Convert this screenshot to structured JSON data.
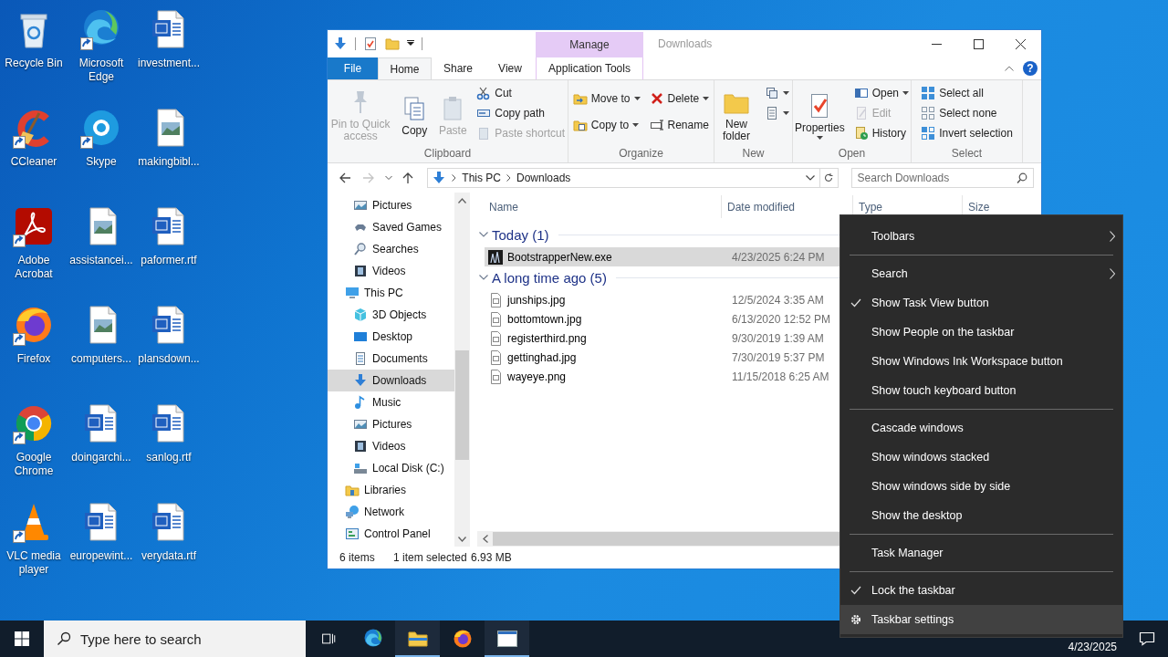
{
  "desktop": {
    "icons": [
      {
        "label": "Recycle Bin",
        "kind": "recycle_bin",
        "shortcut": false
      },
      {
        "label": "CCleaner",
        "kind": "ccleaner",
        "shortcut": true
      },
      {
        "label": "Adobe Acrobat",
        "kind": "acrobat",
        "shortcut": true
      },
      {
        "label": "Firefox",
        "kind": "firefox",
        "shortcut": true
      },
      {
        "label": "Google Chrome",
        "kind": "chrome",
        "shortcut": true
      },
      {
        "label": "VLC media player",
        "kind": "vlc",
        "shortcut": true
      },
      {
        "label": "Microsoft Edge",
        "kind": "edge",
        "shortcut": true
      },
      {
        "label": "Skype",
        "kind": "skype",
        "shortcut": true
      },
      {
        "label": "assistancei...",
        "kind": "image",
        "shortcut": false
      },
      {
        "label": "computers...",
        "kind": "image",
        "shortcut": false
      },
      {
        "label": "doingarchi...",
        "kind": "word",
        "shortcut": false
      },
      {
        "label": "europewint...",
        "kind": "word",
        "shortcut": false
      },
      {
        "label": "investment...",
        "kind": "word",
        "shortcut": false
      },
      {
        "label": "makingbibl...",
        "kind": "image",
        "shortcut": false
      },
      {
        "label": "paformer.rtf",
        "kind": "word",
        "shortcut": false
      },
      {
        "label": "plansdown...",
        "kind": "word",
        "shortcut": false
      },
      {
        "label": "sanlog.rtf",
        "kind": "word",
        "shortcut": false
      },
      {
        "label": "verydata.rtf",
        "kind": "word",
        "shortcut": false
      }
    ]
  },
  "explorer": {
    "title": "Downloads",
    "context_header": "Manage",
    "tabs": [
      {
        "label": "File",
        "kind": "file",
        "selected": false
      },
      {
        "label": "Home",
        "kind": "tab",
        "selected": true
      },
      {
        "label": "Share",
        "kind": "tab",
        "selected": false
      },
      {
        "label": "View",
        "kind": "tab",
        "selected": false
      },
      {
        "label": "Application Tools",
        "kind": "contextual",
        "selected": false
      }
    ],
    "help": "?",
    "ribbon": {
      "groups": [
        {
          "label": "Clipboard",
          "columns": [
            {
              "kind": "large",
              "items": [
                {
                  "label": "Pin to Quick access",
                  "disabled": true,
                  "dropdown": false
                }
              ]
            },
            {
              "kind": "large",
              "items": [
                {
                  "label": "Copy",
                  "disabled": false,
                  "dropdown": false
                }
              ]
            },
            {
              "kind": "large",
              "items": [
                {
                  "label": "Paste",
                  "disabled": true,
                  "dropdown": false
                }
              ]
            },
            {
              "kind": "small",
              "items": [
                {
                  "label": "Cut",
                  "disabled": false,
                  "dropdown": false
                },
                {
                  "label": "Copy path",
                  "disabled": false,
                  "dropdown": false
                },
                {
                  "label": "Paste shortcut",
                  "disabled": true,
                  "dropdown": false
                }
              ]
            }
          ]
        },
        {
          "label": "Organize",
          "columns": [
            {
              "kind": "small",
              "items": [
                {
                  "label": "Move to",
                  "disabled": false,
                  "dropdown": true
                },
                {
                  "label": "Copy to",
                  "disabled": false,
                  "dropdown": true
                }
              ]
            },
            {
              "kind": "small",
              "items": [
                {
                  "label": "Delete",
                  "disabled": false,
                  "dropdown": true
                },
                {
                  "label": "Rename",
                  "disabled": false,
                  "dropdown": false
                }
              ]
            }
          ]
        },
        {
          "label": "New",
          "columns": [
            {
              "kind": "large",
              "items": [
                {
                  "label": "New folder",
                  "disabled": false,
                  "dropdown": false
                }
              ]
            },
            {
              "kind": "small",
              "items": [
                {
                  "disabled": false,
                  "dropdown": true
                },
                {
                  "disabled": false,
                  "dropdown": true
                }
              ]
            }
          ]
        },
        {
          "label": "Open",
          "columns": [
            {
              "kind": "large",
              "items": [
                {
                  "label": "Properties",
                  "disabled": false,
                  "dropdown": true
                }
              ]
            },
            {
              "kind": "small",
              "items": [
                {
                  "label": "Open",
                  "disabled": false,
                  "dropdown": true
                },
                {
                  "label": "Edit",
                  "disabled": true,
                  "dropdown": false
                },
                {
                  "label": "History",
                  "disabled": false,
                  "dropdown": false
                }
              ]
            }
          ]
        },
        {
          "label": "Select",
          "columns": [
            {
              "kind": "small",
              "items": [
                {
                  "label": "Select all",
                  "disabled": false,
                  "dropdown": false
                },
                {
                  "label": "Select none",
                  "disabled": false,
                  "dropdown": false
                },
                {
                  "label": "Invert selection",
                  "disabled": false,
                  "dropdown": false
                }
              ]
            }
          ]
        }
      ]
    },
    "address": {
      "path": [
        "This PC",
        "Downloads"
      ]
    },
    "search": {
      "placeholder": "Search Downloads"
    },
    "nav": {
      "items": [
        {
          "children": [
            {
              "label": "Pictures",
              "selected": false
            },
            {
              "label": "Saved Games",
              "selected": false
            },
            {
              "label": "Searches",
              "selected": false
            },
            {
              "label": "Videos",
              "selected": false
            }
          ]
        },
        {
          "label": "This PC",
          "selected": false,
          "children": [
            {
              "label": "3D Objects",
              "selected": false
            },
            {
              "label": "Desktop",
              "selected": false
            },
            {
              "label": "Documents",
              "selected": false
            },
            {
              "label": "Downloads",
              "selected": true
            },
            {
              "label": "Music",
              "selected": false
            },
            {
              "label": "Pictures",
              "selected": false
            },
            {
              "label": "Videos",
              "selected": false
            },
            {
              "label": "Local Disk (C:)",
              "selected": false
            }
          ]
        },
        {
          "label": "Libraries",
          "selected": false
        },
        {
          "label": "Network",
          "selected": false
        },
        {
          "label": "Control Panel",
          "selected": false
        }
      ]
    },
    "columns": [
      "Name",
      "Date modified",
      "Type",
      "Size"
    ],
    "groups": [
      {
        "label": "Today (1)",
        "files": [
          {
            "name": "BootstrapperNew.exe",
            "date": "4/23/2025 6:24 PM",
            "kind": "exe",
            "selected": true
          }
        ]
      },
      {
        "label": "A long time ago (5)",
        "files": [
          {
            "name": "junships.jpg",
            "date": "12/5/2024 3:35 AM",
            "kind": "image",
            "selected": false
          },
          {
            "name": "bottomtown.jpg",
            "date": "6/13/2020 12:52 PM",
            "kind": "image",
            "selected": false
          },
          {
            "name": "registerthird.png",
            "date": "9/30/2019 1:39 AM",
            "kind": "image",
            "selected": false
          },
          {
            "name": "gettinghad.jpg",
            "date": "7/30/2019 5:37 PM",
            "kind": "image",
            "selected": false
          },
          {
            "name": "wayeye.png",
            "date": "11/15/2018 6:25 AM",
            "kind": "image",
            "selected": false
          }
        ]
      }
    ],
    "status": {
      "items": "6 items",
      "selection": "1 item selected",
      "size": "6.93 MB"
    }
  },
  "context_menu": {
    "sections": [
      {
        "items": [
          {
            "label": "Toolbars",
            "kind": "command",
            "checked": false,
            "submenu": true,
            "selected": false
          }
        ]
      },
      {
        "items": [
          {
            "label": "Search",
            "kind": "command",
            "checked": false,
            "submenu": true,
            "selected": false
          },
          {
            "label": "Show Task View button",
            "kind": "command",
            "checked": true,
            "submenu": false,
            "selected": false
          },
          {
            "label": "Show People on the taskbar",
            "kind": "command",
            "checked": false,
            "submenu": false,
            "selected": false
          },
          {
            "label": "Show Windows Ink Workspace button",
            "kind": "command",
            "checked": false,
            "submenu": false,
            "selected": false
          },
          {
            "label": "Show touch keyboard button",
            "kind": "command",
            "checked": false,
            "submenu": false,
            "selected": false
          }
        ]
      },
      {
        "items": [
          {
            "label": "Cascade windows",
            "kind": "command",
            "checked": false,
            "submenu": false,
            "selected": false
          },
          {
            "label": "Show windows stacked",
            "kind": "command",
            "checked": false,
            "submenu": false,
            "selected": false
          },
          {
            "label": "Show windows side by side",
            "kind": "command",
            "checked": false,
            "submenu": false,
            "selected": false
          },
          {
            "label": "Show the desktop",
            "kind": "command",
            "checked": false,
            "submenu": false,
            "selected": false
          }
        ]
      },
      {
        "items": [
          {
            "label": "Task Manager",
            "kind": "command",
            "checked": false,
            "submenu": false,
            "selected": false
          }
        ]
      },
      {
        "items": [
          {
            "label": "Lock the taskbar",
            "kind": "command",
            "checked": true,
            "submenu": false,
            "selected": false
          },
          {
            "label": "Taskbar settings",
            "kind": "settings",
            "checked": false,
            "submenu": false,
            "selected": true
          }
        ]
      }
    ]
  },
  "taskbar": {
    "search": {
      "placeholder": "Type here to search"
    },
    "apps": [
      {
        "kind": "edge",
        "active": false
      },
      {
        "kind": "explorer",
        "active": true
      },
      {
        "kind": "firefox",
        "active": false
      },
      {
        "kind": "window",
        "active": true
      }
    ],
    "date": "4/23/2025"
  }
}
